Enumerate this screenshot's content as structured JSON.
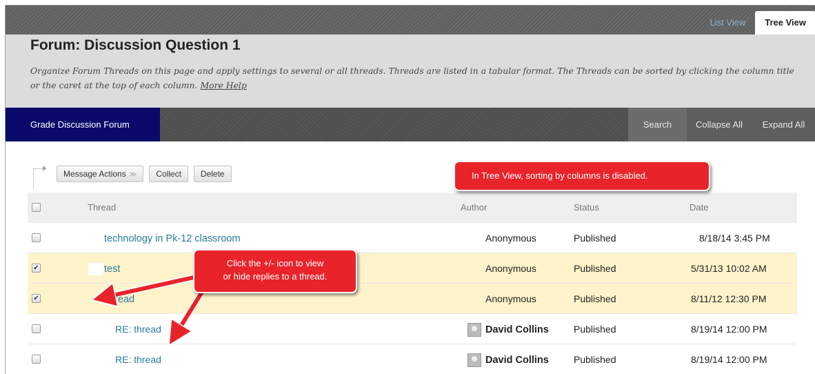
{
  "view_tabs": {
    "list": "List View",
    "tree": "Tree View"
  },
  "header": {
    "title": "Forum: Discussion Question 1",
    "description": "Organize Forum Threads on this page and apply settings to several or all threads. Threads are listed in a tabular format. The Threads can be sorted by clicking the column title or the caret at the top of each column.",
    "more_help": "More Help"
  },
  "action_bar": {
    "grade": "Grade Discussion Forum",
    "search": "Search",
    "collapse_all": "Collapse All",
    "expand_all": "Expand All"
  },
  "tools": {
    "message_actions": "Message Actions",
    "collect": "Collect",
    "delete": "Delete"
  },
  "columns": {
    "thread": "Thread",
    "author": "Author",
    "status": "Status",
    "date": "Date"
  },
  "rows": [
    {
      "thread": "technology in Pk-12 classroom",
      "author": "Anonymous",
      "status": "Published",
      "date": "8/18/14 3:45 PM",
      "checked": false
    },
    {
      "thread": "test",
      "author": "Anonymous",
      "status": "Published",
      "date": "5/31/13 10:02 AM",
      "checked": true
    },
    {
      "thread": "thread",
      "author": "Anonymous",
      "status": "Published",
      "date": "8/11/12 12:30 PM",
      "checked": true
    },
    {
      "thread": "RE: thread",
      "author": "David Collins",
      "status": "Published",
      "date": "8/19/14 12:00 PM",
      "checked": false
    },
    {
      "thread": "RE: thread",
      "author": "David Collins",
      "status": "Published",
      "date": "8/19/14 12:00 PM",
      "checked": false
    }
  ],
  "callouts": {
    "sorting": "In Tree View, sorting by columns is disabled.",
    "toggle_line1": "Click the +/- icon to view",
    "toggle_line2": "or hide replies to a thread."
  },
  "colors": {
    "callout": "#e8242a",
    "link": "#2b7a9e",
    "grade_button": "#0a0a6a",
    "selected_row": "#fff3cc"
  }
}
